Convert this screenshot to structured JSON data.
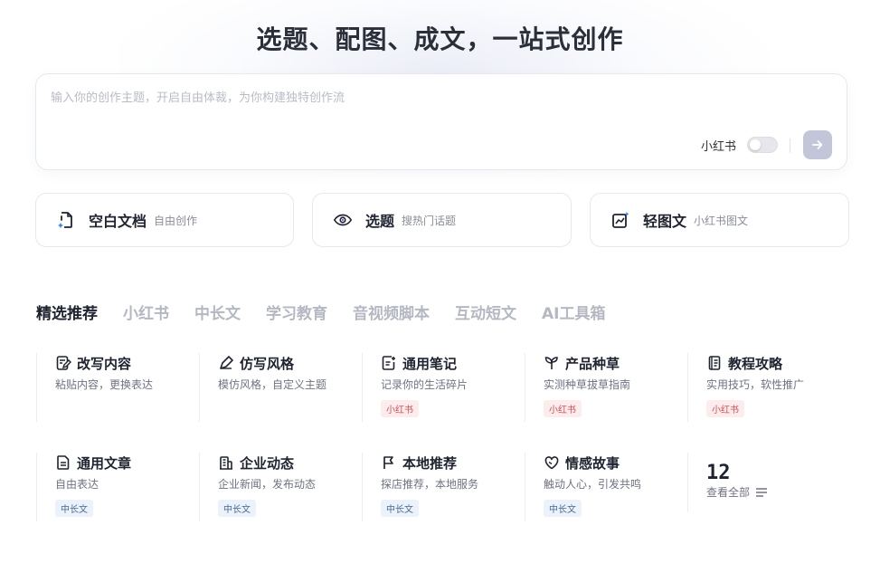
{
  "hero": {
    "title": "选题、配图、成文，一站式创作"
  },
  "prompt": {
    "placeholder": "输入你的创作主题，开启自由体裁，为你构建独特创作流",
    "toggle_label": "小红书",
    "toggle_on": false,
    "send_icon": "arrow-right-icon"
  },
  "modes": [
    {
      "title": "空白文档",
      "subtitle": "自由创作",
      "icon": "blank-doc-icon"
    },
    {
      "title": "选题",
      "subtitle": "搜热门话题",
      "icon": "eye-icon"
    },
    {
      "title": "轻图文",
      "subtitle": "小红书图文",
      "icon": "image-chart-icon"
    }
  ],
  "tabs": [
    "精选推荐",
    "小红书",
    "中长文",
    "学习教育",
    "音视频脚本",
    "互动短文",
    "AI工具箱"
  ],
  "templates": [
    {
      "title": "改写内容",
      "desc": "粘贴内容，更换表达",
      "tag": "",
      "icon": "edit-doc-icon"
    },
    {
      "title": "仿写风格",
      "desc": "模仿风格，自定义主题",
      "tag": "",
      "icon": "pen-icon"
    },
    {
      "title": "通用笔记",
      "desc": "记录你的生活碎片",
      "tag": "小红书",
      "icon": "note-icon"
    },
    {
      "title": "产品种草",
      "desc": "实测种草拔草指南",
      "tag": "小红书",
      "icon": "sprout-icon"
    },
    {
      "title": "教程攻略",
      "desc": "实用技巧，软性推广",
      "tag": "小红书",
      "icon": "book-icon"
    },
    {
      "title": "通用文章",
      "desc": "自由表达",
      "tag": "中长文",
      "icon": "article-icon"
    },
    {
      "title": "企业动态",
      "desc": "企业新闻，发布动态",
      "tag": "中长文",
      "icon": "building-icon"
    },
    {
      "title": "本地推荐",
      "desc": "探店推荐，本地服务",
      "tag": "中长文",
      "icon": "flag-icon"
    },
    {
      "title": "情感故事",
      "desc": "触动人心，引发共鸣",
      "tag": "中长文",
      "icon": "heart-chat-icon"
    }
  ],
  "more": {
    "count": "12",
    "label": "查看全部",
    "icon": "list-icon"
  },
  "colors": {
    "accent": "#5b5fe0",
    "tag_red_text": "#d0505a",
    "tag_blue_text": "#4a6a92"
  }
}
